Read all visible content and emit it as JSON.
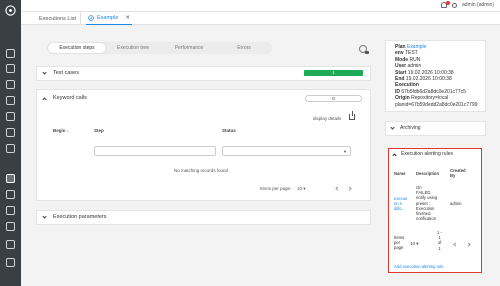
{
  "topbar": {
    "user": "admin (admin)"
  },
  "tabs": [
    {
      "label": "Executions List"
    },
    {
      "label": "Example"
    }
  ],
  "modes": [
    "Execution steps",
    "Execution tree",
    "Performance",
    "Errors"
  ],
  "test_cases": {
    "title": "Test cases",
    "count": "1"
  },
  "keyword_calls": {
    "title": "Keyword calls",
    "count": "0",
    "display_details": "display details",
    "columns": [
      "Begin",
      "Step",
      "Status"
    ],
    "empty_message": "No matching records found",
    "items_per_page_label": "Items per page:",
    "items_per_page": "10"
  },
  "execution_parameters": {
    "title": "Execution parameters"
  },
  "info": [
    {
      "key": "Plan",
      "value": "Example",
      "link": true
    },
    {
      "key": "env",
      "value": "TEST"
    },
    {
      "key": "Mode",
      "value": "RUN"
    },
    {
      "key": "User",
      "value": "admin"
    },
    {
      "key": "Start",
      "value": "19.02.2026 10:00:38"
    },
    {
      "key": "End",
      "value": "19.02.2026 10:00:38"
    },
    {
      "key": "Execution",
      "value": ""
    },
    {
      "key": "ID",
      "value": "67b5fdb6d2a8dc0e201c77c5"
    },
    {
      "key": "Origin",
      "value": "Repository=local"
    },
    {
      "key": "",
      "value": "planid=67b59dedd2a8dc0e201c7799"
    }
  ],
  "archiving": {
    "title": "Archiving"
  },
  "alerting": {
    "title": "Execution alerting rules",
    "columns": [
      "Name",
      "Description",
      "Created By"
    ],
    "row": {
      "name": "executi on s dillo...",
      "description": "On FAILED, notify using preset : Execution finished notification",
      "created_by": "admin"
    },
    "items_per_page_label": "Items per page",
    "items_per_page": "10",
    "range": "1 - 1 of 1",
    "add_label": "Add execution alerting rule"
  }
}
